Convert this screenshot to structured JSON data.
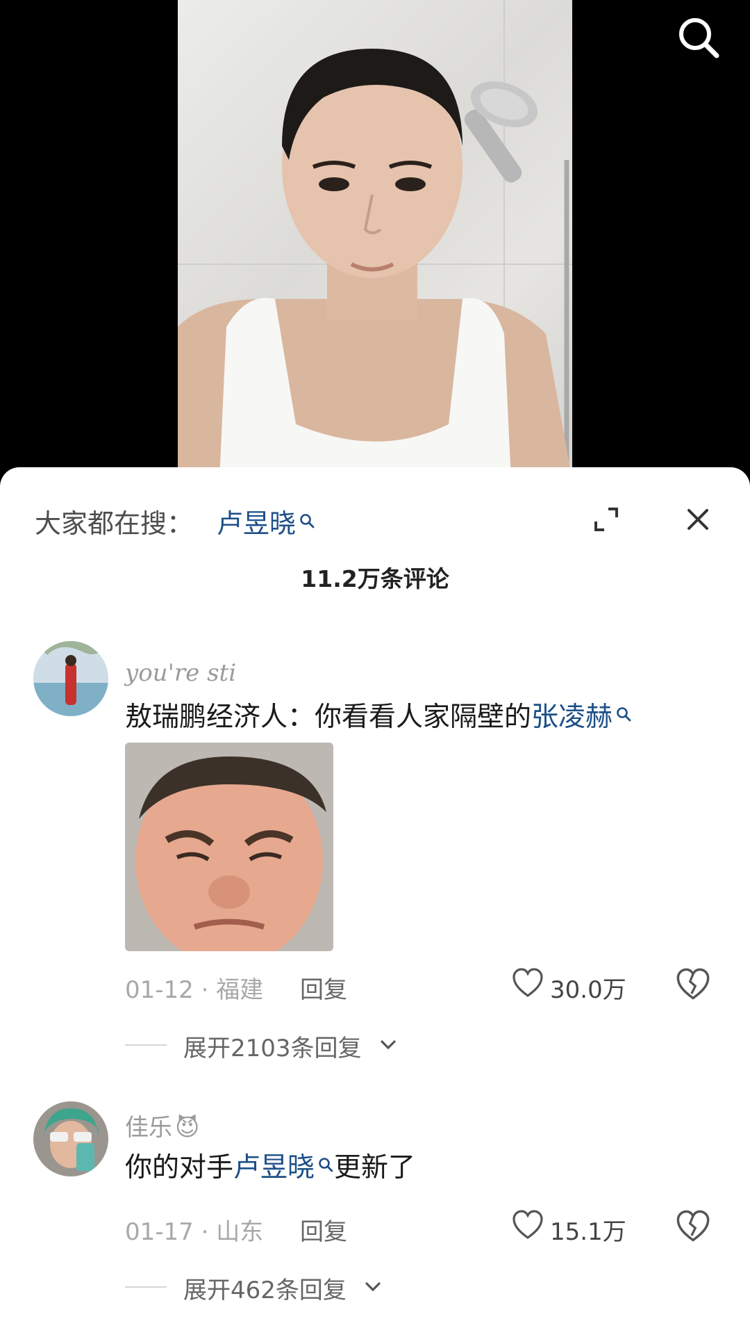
{
  "top_bar": {
    "search_icon": "search-icon"
  },
  "sheet": {
    "trending_label": "大家都在搜：",
    "trending_term": "卢昱晓",
    "comment_count": "11.2万条评论"
  },
  "comments": [
    {
      "username": "you're sti",
      "text_prefix": "敖瑞鹏经济人：你看看人家隔壁的",
      "text_link": "张凌赫",
      "text_suffix": "",
      "date_location": "01-12 · 福建",
      "reply_label": "回复",
      "likes": "30.0万",
      "expand_replies": "展开2103条回复"
    },
    {
      "username": "佳乐",
      "username_emoji": "😈",
      "text_prefix": "你的对手",
      "text_link": "卢昱晓",
      "text_suffix": "更新了",
      "date_location": "01-17 · 山东",
      "reply_label": "回复",
      "likes": "15.1万",
      "expand_replies": "展开462条回复"
    }
  ],
  "colors": {
    "link": "#1d4f87",
    "muted": "#a8a8a8",
    "text": "#1a1a1a"
  }
}
